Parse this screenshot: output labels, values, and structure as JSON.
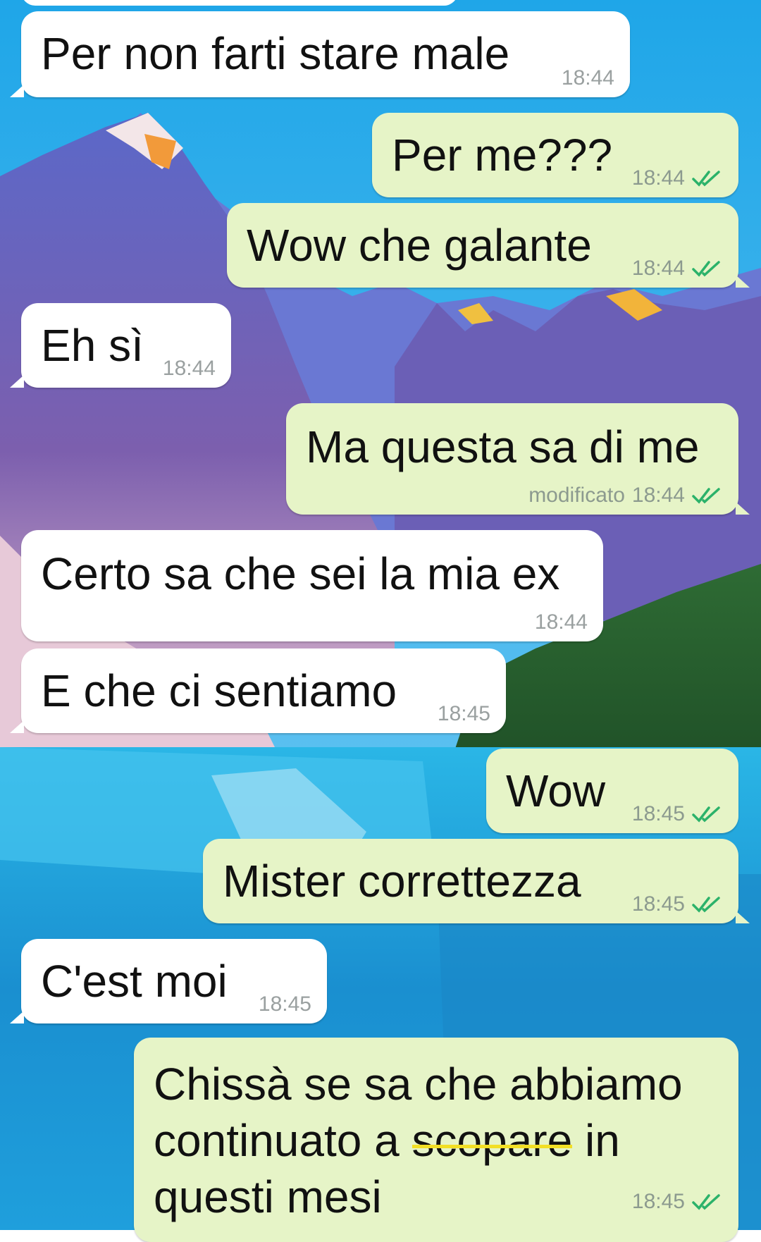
{
  "theme": {
    "incoming_bg": "#ffffff",
    "outgoing_bg": "#e6f4c7",
    "tick_color": "#34b7f1",
    "strike_color": "#f2df25"
  },
  "messages": [
    {
      "side": "in",
      "text": "Per non farti stare male",
      "time": "18:44"
    },
    {
      "side": "out",
      "text": "Per me???",
      "time": "18:44",
      "status": "read"
    },
    {
      "side": "out",
      "text": "Wow che galante",
      "time": "18:44",
      "status": "read"
    },
    {
      "side": "in",
      "text": "Eh sì",
      "time": "18:44"
    },
    {
      "side": "out",
      "text": "Ma questa sa di me",
      "edited_label": "modificato",
      "time": "18:44",
      "status": "read"
    },
    {
      "side": "in",
      "text": "Certo sa che sei la mia ex",
      "time": "18:44"
    },
    {
      "side": "in",
      "text": "E che ci sentiamo",
      "time": "18:45"
    },
    {
      "side": "out",
      "text": "Wow",
      "time": "18:45",
      "status": "read"
    },
    {
      "side": "out",
      "text": "Mister correttezza",
      "time": "18:45",
      "status": "read"
    },
    {
      "side": "in",
      "text": "C'est moi",
      "time": "18:45"
    },
    {
      "side": "out",
      "text_line1": "Chissà se sa che abbiamo",
      "text_line2_before": "continuato a ",
      "text_line2_struck": "scopare",
      "text_line2_after": " in",
      "text_line3": "questi mesi",
      "time": "18:45",
      "status": "read"
    }
  ]
}
